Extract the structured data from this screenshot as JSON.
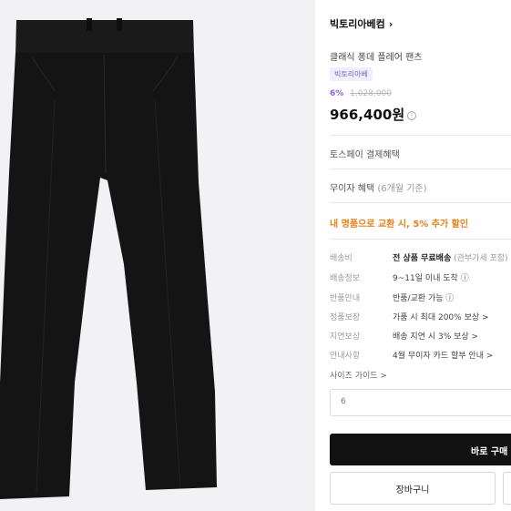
{
  "product_image": {
    "alt": "black flare pants"
  },
  "brand": {
    "name": "빅토리아베컴",
    "chevron_icon": "chevron-right-icon"
  },
  "product": {
    "name": "클래식 퐁데 플레어 팬츠",
    "badge": "빅토리아베",
    "discount_percent": "6%",
    "original_price": "1,028,000",
    "price": "966,400원",
    "price_info_icon": "info-icon"
  },
  "benefits": {
    "toss": "토스페이 결제혜택",
    "musinsa_label": "무이자 혜택",
    "musinsa_note": "(6개월 기준)",
    "promo": "내 명품으로 교환 시, 5% 추가 할인"
  },
  "details": [
    {
      "key": "배송비",
      "value": "전 상품 무료배송",
      "note": "(관부가세 포함)"
    },
    {
      "key": "배송정보",
      "value": "9~11일 이내 도착 ⓘ",
      "note": ""
    },
    {
      "key": "반품안내",
      "value": "반품/교환 가능 ⓘ",
      "note": ""
    },
    {
      "key": "정품보장",
      "value": "가품 시 최대 200% 보상 >",
      "note": ""
    },
    {
      "key": "지연보상",
      "value": "배송 지연 시 3% 보상 >",
      "note": ""
    },
    {
      "key": "안내사항",
      "value": "4월 무이자 카드 할부 안내 >",
      "note": ""
    }
  ],
  "size_guide": "사이즈 가이드 >",
  "size_select": {
    "value": "6"
  },
  "buttons": {
    "buy_now": "바로 구매",
    "cart": "장바구니"
  }
}
